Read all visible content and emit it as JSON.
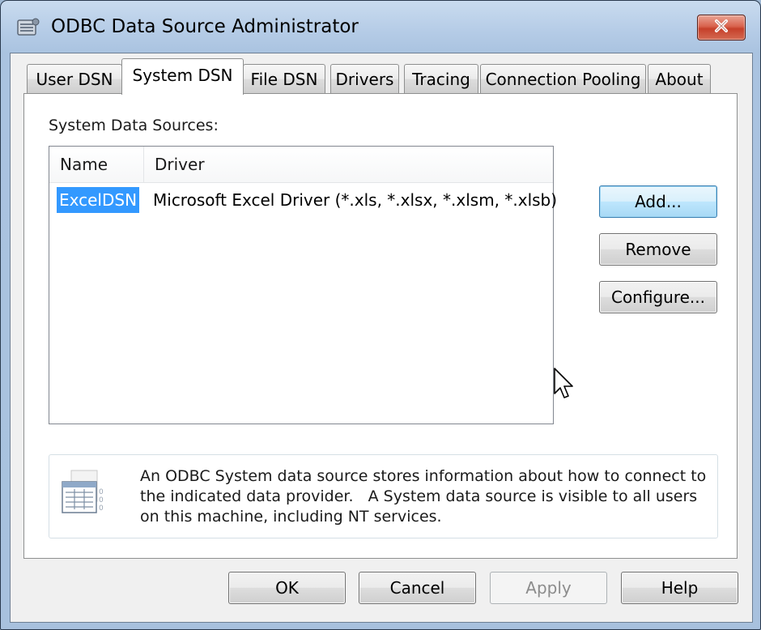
{
  "window": {
    "title": "ODBC Data Source Administrator",
    "icons": {
      "app": "odbc-admin-icon",
      "close": "close-icon"
    }
  },
  "tabs": [
    {
      "label": "User DSN"
    },
    {
      "label": "System DSN",
      "active": true
    },
    {
      "label": "File DSN"
    },
    {
      "label": "Drivers"
    },
    {
      "label": "Tracing"
    },
    {
      "label": "Connection Pooling"
    },
    {
      "label": "About"
    }
  ],
  "panel": {
    "section_label": "System Data Sources:",
    "list": {
      "columns": [
        "Name",
        "Driver"
      ],
      "rows": [
        {
          "name": "ExcelDSN",
          "driver": "Microsoft Excel Driver (*.xls, *.xlsx, *.xlsm, *.xlsb)",
          "selected": true
        }
      ]
    },
    "buttons": {
      "add": "Add...",
      "remove": "Remove",
      "configure": "Configure..."
    },
    "info": {
      "icon": "datasource-table-icon",
      "lines": [
        "An ODBC System data source stores information about how to connect to",
        "the indicated data provider.   A System data source is visible to all users",
        "on this machine, including NT services."
      ]
    }
  },
  "footer_buttons": {
    "ok": "OK",
    "cancel": "Cancel",
    "apply": "Apply",
    "help": "Help"
  },
  "colors": {
    "selection": "#3399ff",
    "close_button": "#c6402a",
    "frame": "#b4cbe6"
  }
}
